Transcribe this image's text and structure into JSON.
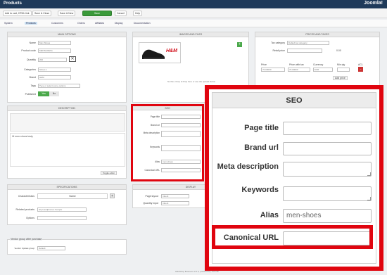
{
  "app": {
    "title": "Products",
    "brand": "Joomla!"
  },
  "toolbar": {
    "buttons": [
      {
        "label": "Add to cart, HTML link"
      },
      {
        "label": "Save & Close"
      },
      {
        "label": "Save & New"
      },
      {
        "label": "Save"
      },
      {
        "label": "Cancel"
      },
      {
        "label": "Help"
      }
    ]
  },
  "menu": {
    "items": [
      {
        "label": "System"
      },
      {
        "label": "Products"
      },
      {
        "label": "Customers"
      },
      {
        "label": "Orders"
      },
      {
        "label": "Affiliates"
      },
      {
        "label": "Display"
      },
      {
        "label": "Documentation"
      }
    ]
  },
  "main_options": {
    "title": "MAIN OPTIONS",
    "name_label": "Name",
    "name_value": "Men Shoes",
    "code_label": "Product code",
    "code_value": "MENSHOES1",
    "qty_label": "Quantity",
    "qty_value": "200",
    "categories_label": "Categories",
    "categories_value": "Shoes x",
    "brand_label": "Brand",
    "brand_value": "H&M",
    "tags_label": "Tags",
    "tags_placeholder": "Type or select some options",
    "published_label": "Published",
    "yes": "Yes",
    "no": "No"
  },
  "images": {
    "title": "IMAGES AND FILES",
    "note": "No files. Drop & Drop here or use the upload button",
    "logo": "H&M"
  },
  "prices": {
    "title": "PRICES AND TAXES",
    "tax_label": "Tax category",
    "tax_value": "Default tax category",
    "retail_label": "Retail price",
    "retail_value": "0.00",
    "col_price": "Price",
    "col_price_tax": "Price with tax",
    "col_currency": "Currency",
    "col_min": "Min qty",
    "col_acl": "ACL",
    "price": "70.00000",
    "price_tax": "70.00000",
    "currency": "EUR",
    "add_price": "Add price"
  },
  "description": {
    "title": "DESCRIPTION",
    "text": "Hi men shoes testy",
    "toggle": "Toggle editor"
  },
  "specifications": {
    "title": "SPECIFICATIONS",
    "char_label": "Characteristics",
    "char_col": "Name",
    "related_label": "Related products",
    "related_value": "HQ Headphones Sample",
    "options_label": "Options"
  },
  "display": {
    "title": "DISPLAY",
    "page_layout_label": "Page layout",
    "page_layout_value": "Inherit",
    "qty_input_label": "Quantity input",
    "qty_input_value": "Inherit"
  },
  "vendor": {
    "title": "Vendor group after purchase",
    "label": "Vendor Update group",
    "value": "Default"
  },
  "seo": {
    "title": "SEO",
    "page_title_label": "Page title",
    "page_title_value": "",
    "brand_url_label": "Brand url",
    "brand_url_value": "",
    "meta_label": "Meta description",
    "meta_value": "",
    "keywords_label": "Keywords",
    "keywords_value": "",
    "alias_label": "Alias",
    "alias_value": "men-shoes",
    "canonical_label": "Canonical URL",
    "canonical_value": ""
  },
  "footer": {
    "text": "HikaShop Business 2.6.3, powered by Joomla!"
  }
}
